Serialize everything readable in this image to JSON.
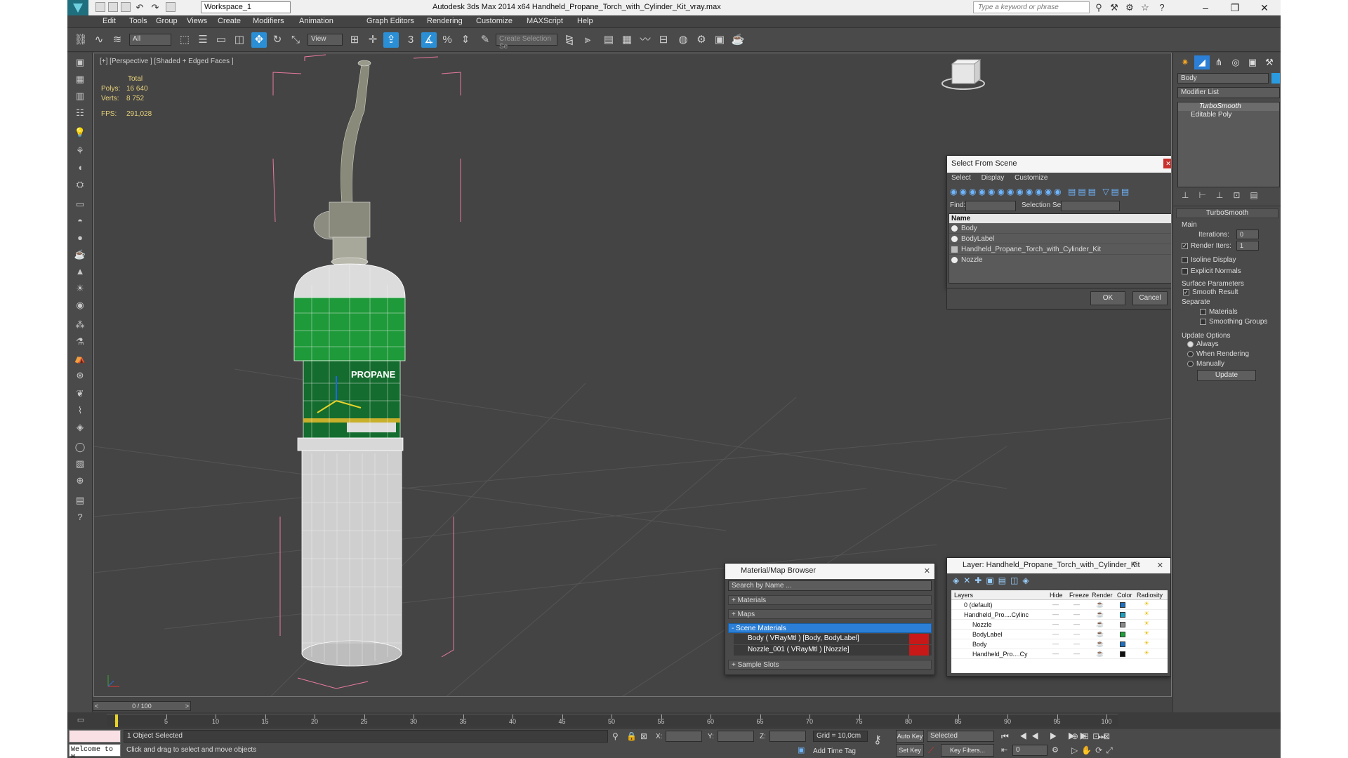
{
  "window": {
    "title": "Autodesk 3ds Max  2014 x64      Handheld_Propane_Torch_with_Cylinder_Kit_vray.max",
    "workspace": "Workspace_1",
    "search_placeholder": "Type a keyword or phrase"
  },
  "menu": [
    "Edit",
    "Tools",
    "Group",
    "Views",
    "Create",
    "Modifiers",
    "Animation",
    "Graph Editors",
    "Rendering",
    "Customize",
    "MAXScript",
    "Help"
  ],
  "toolbar": {
    "filter": "All",
    "coord": "View",
    "snap_angle": "3",
    "named_selection_placeholder": "Create Selection Se"
  },
  "viewport": {
    "label": "[+] [Perspective ] [Shaded + Edged Faces ]",
    "stats_total": "Total",
    "polys_label": "Polys:",
    "polys_value": "16 640",
    "verts_label": "Verts:",
    "verts_value": "8 752",
    "fps_label": "FPS:",
    "fps_value": "291,028",
    "label_text": "PROPANE"
  },
  "command_panel": {
    "object_name": "Body",
    "modifier_list": "Modifier List",
    "stack": [
      "TurboSmooth",
      "Editable Poly"
    ],
    "rollout_title": "TurboSmooth",
    "main_group": "Main",
    "iterations_label": "Iterations:",
    "iterations_value": "0",
    "render_iters_label": "Render Iters:",
    "render_iters_value": "1",
    "isoline": "Isoline Display",
    "explicit_normals": "Explicit Normals",
    "surface_params": "Surface Parameters",
    "smooth_result": "Smooth Result",
    "separate": "Separate",
    "materials": "Materials",
    "smoothing_groups": "Smoothing Groups",
    "update_options": "Update Options",
    "always": "Always",
    "when_rendering": "When Rendering",
    "manually": "Manually",
    "update_button": "Update"
  },
  "select_from_scene": {
    "title": "Select From Scene",
    "menu": [
      "Select",
      "Display",
      "Customize"
    ],
    "find_label": "Find:",
    "selection_set_label": "Selection Set:",
    "column_name": "Name",
    "items": [
      "Body",
      "BodyLabel",
      "Handheld_Propane_Torch_with_Cylinder_Kit",
      "Nozzle"
    ],
    "ok": "OK",
    "cancel": "Cancel"
  },
  "material_browser": {
    "title": "Material/Map Browser",
    "search_placeholder": "Search by Name ...",
    "sections": [
      "+ Materials",
      "+ Maps",
      "- Scene Materials",
      "+ Sample Slots"
    ],
    "scene_materials": [
      "Body  ( VRayMtl ) [Body, BodyLabel]",
      "Nozzle_001  ( VRayMtl ) [Nozzle]"
    ]
  },
  "layer_dialog": {
    "title": "Layer: Handheld_Propane_Torch_with_Cylinder_Kit",
    "help": "?",
    "columns": [
      "Layers",
      "Hide",
      "Freeze",
      "Render",
      "Color",
      "Radiosity"
    ],
    "rows": [
      {
        "name": "0 (default)",
        "color": "#1e6fbf"
      },
      {
        "name": "Handheld_Pro....Cylinc",
        "color": "#1e9fbf"
      },
      {
        "name": "Nozzle",
        "color": "#8a8a8a"
      },
      {
        "name": "BodyLabel",
        "color": "#1fa13a"
      },
      {
        "name": "Body",
        "color": "#1e6fbf"
      },
      {
        "name": "Handheld_Pro....Cy",
        "color": "#111111"
      }
    ]
  },
  "timeline": {
    "frame": "0 / 100",
    "ticks": [
      "0",
      "5",
      "10",
      "15",
      "20",
      "25",
      "30",
      "35",
      "40",
      "45",
      "50",
      "55",
      "60",
      "65",
      "70",
      "75",
      "80",
      "85",
      "90",
      "95",
      "100"
    ]
  },
  "status": {
    "listener": "Welcome to M",
    "selected": "1 Object Selected",
    "prompt": "Click and drag to select and move objects",
    "x_label": "X:",
    "y_label": "Y:",
    "z_label": "Z:",
    "grid": "Grid = 10,0cm",
    "add_time_tag": "Add Time Tag",
    "auto_key": "Auto Key",
    "set_key": "Set Key",
    "key_mode": "Selected",
    "key_filters": "Key Filters...",
    "frame_value": "0"
  }
}
